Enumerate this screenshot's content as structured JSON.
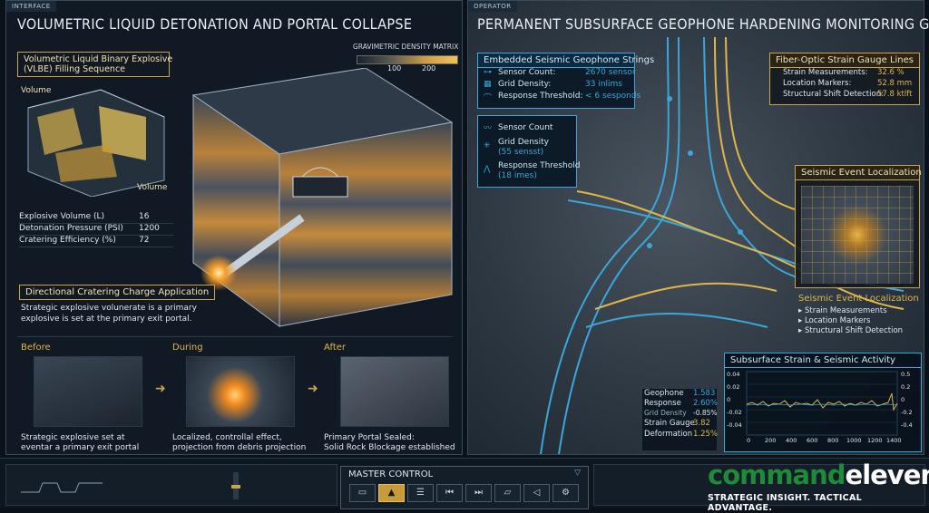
{
  "left_panel": {
    "tag": "INTERFACE",
    "title": "VOLUMETRIC LIQUID DETONATION AND PORTAL COLLAPSE",
    "density_legend": {
      "title": "GRAVIMETRIC DENSITY MATRIX",
      "tick_100": "100",
      "tick_200": "200"
    },
    "vlbe_box": {
      "line1": "Volumetric Liquid Binary Explosive",
      "line2": "(VLBE) Filling Sequence",
      "label_a": "Volume",
      "label_b": "Volume"
    },
    "stats": [
      {
        "label": "Explosive Volume (L)",
        "value": "16"
      },
      {
        "label": "Detonation Pressure (PSI)",
        "value": "1200"
      },
      {
        "label": "Cratering Efficiency (%)",
        "value": "72"
      }
    ],
    "charge_label": "Directional Cratering Charge Application",
    "charge_desc1": "Strategic explosive volunerate is a primary",
    "charge_desc2": "explosive is set at the primary exit portal.",
    "stages": [
      {
        "title": "Before",
        "desc1": "Strategic explosive set at",
        "desc2": "eventar a primary exit portal"
      },
      {
        "title": "During",
        "desc1": "Localized, controllal effect,",
        "desc2": "projection from debris projection"
      },
      {
        "title": "After",
        "desc1": "Primary Portal Sealed:",
        "desc2": "Solid Rock Blockage established"
      }
    ]
  },
  "right_panel": {
    "tag": "OPERATOR",
    "title": "PERMANENT SUBSURFACE GEOPHONE HARDENING MONITORING GRID",
    "geophone_box": {
      "title": "Embedded Seismic Geophone Strings",
      "rows": [
        {
          "icon": "sensor-icon",
          "label": "Sensor Count:",
          "value": "2670 sensor"
        },
        {
          "icon": "grid-icon",
          "label": "Grid Density:",
          "value": "33 inlims"
        },
        {
          "icon": "threshold-icon",
          "label": "Response Threshold:",
          "value": "< 6 sesponds"
        }
      ],
      "list": [
        {
          "label": "Sensor Count",
          "sub": ""
        },
        {
          "label": "Grid Density",
          "sub": "(55 sensst)"
        },
        {
          "label": "Response Threshold",
          "sub": "(18 imes)"
        }
      ]
    },
    "fiber_box": {
      "title": "Fiber-Optic Strain Gauge Lines",
      "rows": [
        {
          "label": "Strain Measurements:",
          "value": "32.6 %"
        },
        {
          "label": "Location Markers:",
          "value": "52.8 mm"
        },
        {
          "label": "Structural Shift Detection:",
          "value": "57.8 ktlft"
        }
      ]
    },
    "event_box": {
      "title": "Seismic Event Localization",
      "sub_title": "Seismic Event Localization",
      "items": [
        "Strain Measurements",
        "Location Markers",
        "Structural Shift Detection"
      ]
    },
    "activity_box": {
      "title": "Subsurface Strain & Seismic Activity",
      "left_ticks": [
        "0.04",
        "0.02",
        "0",
        "-0.02",
        "-0.04"
      ],
      "right_ticks": [
        "0.5",
        "0.2",
        "0",
        "-0.2",
        "-0.4"
      ],
      "x_ticks": [
        "0",
        "200",
        "400",
        "600",
        "800",
        "1000",
        "1200",
        "1400"
      ]
    },
    "readout": [
      {
        "label": "Geophone",
        "value": "1.583",
        "color": "#3aa6d9"
      },
      {
        "label": "Response",
        "value": "2.60%",
        "color": "#3aa6d9"
      },
      {
        "label": "Grid Density",
        "value": "-0.85%",
        "color": "#dfe7ef"
      },
      {
        "label": "Strain Gauge",
        "value": "3.82",
        "color": "#e0b64a"
      },
      {
        "label": "Deformation",
        "value": "1.25%",
        "color": "#e0b64a"
      }
    ]
  },
  "bottom_bar": {
    "master_control": "MASTER CONTROL",
    "buttons": [
      {
        "name": "screen-icon",
        "glyph": "▭"
      },
      {
        "name": "eject-icon",
        "glyph": "▲"
      },
      {
        "name": "list-icon",
        "glyph": "☰"
      },
      {
        "name": "skip-back-icon",
        "glyph": "⏮"
      },
      {
        "name": "skip-forward-icon",
        "glyph": "⏭"
      },
      {
        "name": "folder-icon",
        "glyph": "▱"
      },
      {
        "name": "volume-icon",
        "glyph": "◁"
      },
      {
        "name": "settings-icon",
        "glyph": "⚙"
      }
    ],
    "brand_part1": "command",
    "brand_part2": "eleven",
    "tagline": "STRATEGIC INSIGHT. TACTICAL ADVANTAGE."
  },
  "colors": {
    "accent_gold": "#e0b64a",
    "accent_blue": "#3aa6d9",
    "brand_green": "#1f8a3a"
  }
}
